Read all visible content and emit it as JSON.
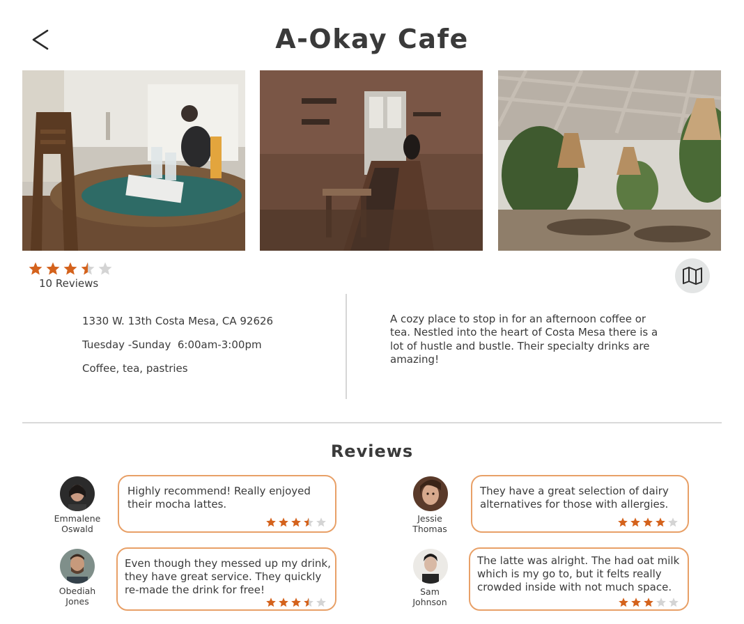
{
  "header": {
    "title": "A-Okay Cafe",
    "back_icon": "chevron-left-icon"
  },
  "photos": [
    {
      "name": "cafe-photo-table"
    },
    {
      "name": "cafe-photo-counter"
    },
    {
      "name": "cafe-photo-patio"
    }
  ],
  "rating": {
    "stars": 3.5,
    "max": 5,
    "count_label": "10 Reviews"
  },
  "map_button": {
    "icon": "map-icon"
  },
  "info": {
    "address": "1330 W. 13th Costa Mesa, CA 92626",
    "hours": "Tuesday -Sunday  6:00am-3:00pm",
    "menu": "Coffee, tea, pastries"
  },
  "description": "A cozy place to stop in for an afternoon coffee or tea. Nestled into the heart of Costa Mesa there is a lot of hustle and bustle. Their specialty drinks are amazing!",
  "reviews_heading": "Reviews",
  "reviews": [
    {
      "name": "Emmalene\nOswald",
      "text": "Highly recommend! Really enjoyed their mocha lattes.",
      "stars": 3.5
    },
    {
      "name": "Jessie\nThomas",
      "text": "They have a great selection of dairy alternatives for those with allergies.",
      "stars": 4
    },
    {
      "name": "Obediah\nJones",
      "text": "Even though they messed up my drink, they have great service. They quickly re-made the drink for free!",
      "stars": 3.5
    },
    {
      "name": "Sam\nJohnson",
      "text": "The latte was alright. The had oat milk which is my go to, but it felts really crowded inside with not much space.",
      "stars": 3
    }
  ],
  "colors": {
    "star_filled": "#d4621c",
    "star_empty": "#d4d4d4",
    "bubble_border": "#e8a067",
    "text": "#3a3a3a"
  }
}
